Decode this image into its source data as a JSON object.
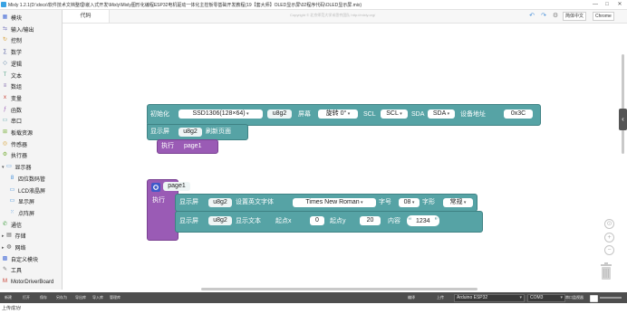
{
  "window": {
    "title": "Mixly 1.2.1(D:\\docs\\软件技术文档整理\\嵌入式开发\\Mixly\\Mixly图形化编程ESP32电机驱动一体化主控板零基础开发教程(19【套大师】OLED显示屏\\02程序代码\\OLED显示屏.mix)",
    "min": "—",
    "max": "□",
    "close": "✕"
  },
  "sidebar": {
    "items": [
      {
        "label": "模块",
        "icon": "blocks-icon",
        "color": "#4a6fd8"
      },
      {
        "label": "输入/输出",
        "icon": "io-icon",
        "color": "#7b7bbf"
      },
      {
        "label": "控制",
        "icon": "control-icon",
        "color": "#d79c2f"
      },
      {
        "label": "数学",
        "icon": "math-icon",
        "color": "#5b67a5"
      },
      {
        "label": "逻辑",
        "icon": "logic-icon",
        "color": "#5b80a5"
      },
      {
        "label": "文本",
        "icon": "text-icon",
        "color": "#5ba58c"
      },
      {
        "label": "数组",
        "icon": "array-icon",
        "color": "#745ba5"
      },
      {
        "label": "变量",
        "icon": "variable-icon",
        "color": "#c6392b"
      },
      {
        "label": "函数",
        "icon": "function-icon",
        "color": "#9a5bb5"
      },
      {
        "label": "串口",
        "icon": "serial-icon",
        "color": "#56a3a5"
      },
      {
        "label": "板载资源",
        "icon": "board-icon",
        "color": "#7ab03c"
      },
      {
        "label": "传感器",
        "icon": "sensor-icon",
        "color": "#d7a43a"
      },
      {
        "label": "执行器",
        "icon": "actuator-icon",
        "color": "#7ab03c"
      },
      {
        "label": "显示器",
        "icon": "display-icon",
        "color": "#3d8bd8"
      },
      {
        "label": "四位数码管",
        "icon": "segment-icon",
        "color": "#3d8bd8"
      },
      {
        "label": "LCD液晶屏",
        "icon": "lcd-icon",
        "color": "#3d8bd8"
      },
      {
        "label": "显示屏",
        "icon": "screen-icon",
        "color": "#3d8bd8"
      },
      {
        "label": "点阵屏",
        "icon": "matrix-icon",
        "color": "#3d8bd8"
      },
      {
        "label": "通信",
        "icon": "comm-icon",
        "color": "#3d9c3d"
      },
      {
        "label": "存储",
        "icon": "storage-icon",
        "color": "#555555"
      },
      {
        "label": "网络",
        "icon": "network-icon",
        "color": "#555555"
      },
      {
        "label": "自定义模块",
        "icon": "custom-icon",
        "color": "#4a6fd8"
      },
      {
        "label": "工具",
        "icon": "tools-icon",
        "color": "#777777"
      },
      {
        "label": "MotorDriverBoard",
        "icon": "motor-icon",
        "color": "#c6392b"
      }
    ]
  },
  "topbar": {
    "code_tab": "代码",
    "language": "简体中文",
    "theme": "Chrome"
  },
  "workspace": {
    "copyright": "Copyright © 北京师范大学米思齐团队 http://mixly.org/",
    "init_block": {
      "init_label": "初始化",
      "model": "SSD1306(128×64)",
      "var": "u8g2",
      "screen_label": "屏幕",
      "rotate": "旋转 0°",
      "scl_label": "SCL",
      "scl": "SCL",
      "sda_label": "SDA",
      "sda": "SDA",
      "addr_label": "设备地址",
      "addr": "0x3C"
    },
    "refresh_block": {
      "prefix": "显示屏",
      "var": "u8g2",
      "label": "刷新页面"
    },
    "exec_label": "执行",
    "exec_func": "page1",
    "func_block": {
      "name": "page1",
      "exec": "执行"
    },
    "font_block": {
      "prefix": "显示屏",
      "var": "u8g2",
      "label": "设置英文字体",
      "font": "Times New Roman",
      "size_label": "字号",
      "size": "08",
      "style_label": "字形",
      "style": "常规"
    },
    "text_block": {
      "prefix": "显示屏",
      "var": "u8g2",
      "label": "显示文本",
      "x_label": "起点x",
      "x": "0",
      "y_label": "起点y",
      "y": "20",
      "content_label": "内容",
      "content": "1234"
    }
  },
  "bottombar": {
    "buttons": [
      "新建",
      "打开",
      "保存",
      "另存为",
      "导出库",
      "导入库",
      "管理库"
    ],
    "compile": "编译",
    "upload": "上传",
    "board": "Arduino ESP32",
    "port": "COM3",
    "serial_monitor": "串口监视器"
  },
  "output": {
    "message": "上传成功!"
  }
}
